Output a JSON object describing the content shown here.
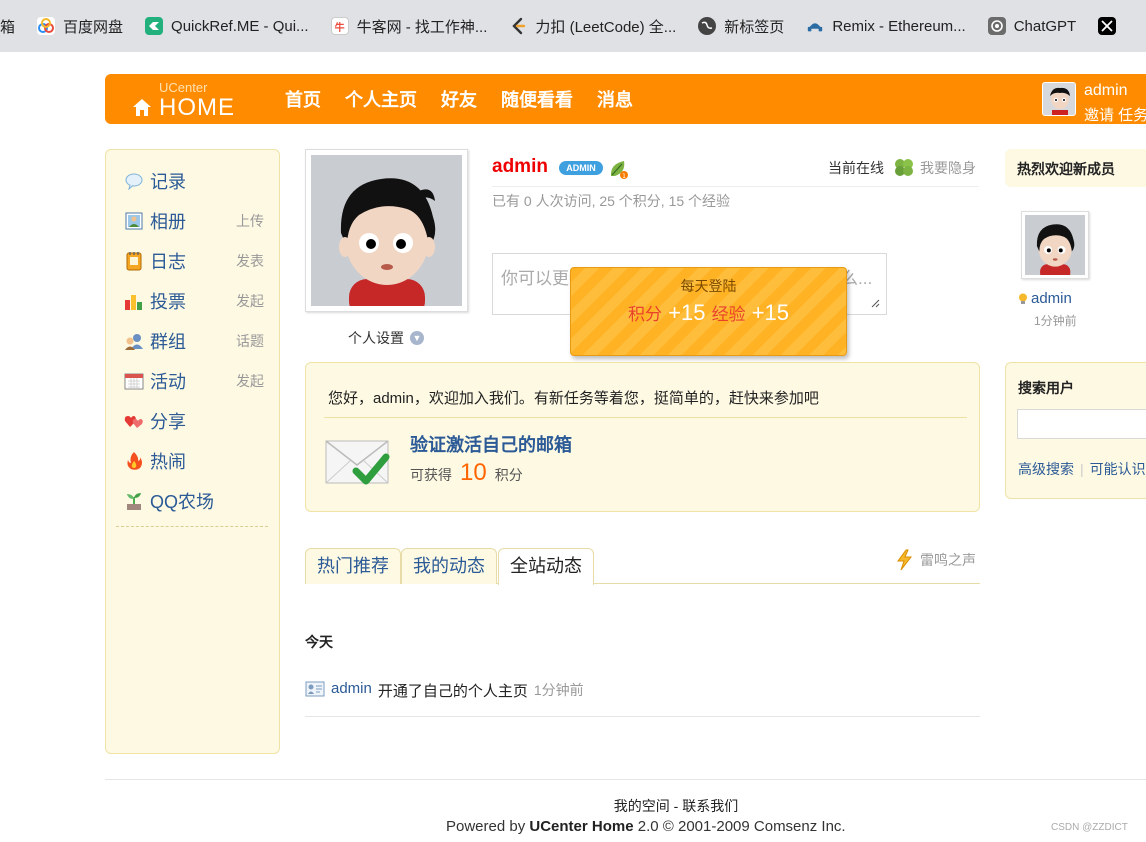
{
  "bookmarks": [
    {
      "label": "箱",
      "color": "#888888"
    },
    {
      "label": "百度网盘",
      "color": "#2a8ef5"
    },
    {
      "label": "QuickRef.ME - Qui...",
      "color": "#22b07d"
    },
    {
      "label": "牛客网 - 找工作神...",
      "color": "#e94b3c"
    },
    {
      "label": "力扣 (LeetCode) 全...",
      "color": "#333333"
    },
    {
      "label": "新标签页",
      "color": "#555555"
    },
    {
      "label": "Remix - Ethereum...",
      "color": "#2b6ca3"
    },
    {
      "label": "ChatGPT",
      "color": "#555555"
    },
    {
      "label": "",
      "color": "#000000"
    }
  ],
  "header": {
    "logo_small": "UCenter",
    "logo_big": "HOME",
    "nav": [
      "首页",
      "个人主页",
      "好友",
      "随便看看",
      "消息"
    ],
    "username": "admin",
    "user_links": "邀请 任务"
  },
  "sidebar": {
    "items": [
      {
        "label": "记录",
        "action": "",
        "icon": "chat-bubble-icon"
      },
      {
        "label": "相册",
        "action": "上传",
        "icon": "photo-icon"
      },
      {
        "label": "日志",
        "action": "发表",
        "icon": "notebook-icon"
      },
      {
        "label": "投票",
        "action": "发起",
        "icon": "bar-chart-icon"
      },
      {
        "label": "群组",
        "action": "话题",
        "icon": "group-icon"
      },
      {
        "label": "活动",
        "action": "发起",
        "icon": "calendar-icon"
      },
      {
        "label": "分享",
        "action": "",
        "icon": "hearts-icon"
      },
      {
        "label": "热闹",
        "action": "",
        "icon": "fire-icon"
      },
      {
        "label": "QQ农场",
        "action": "",
        "icon": "sprout-icon"
      }
    ]
  },
  "profile": {
    "name": "admin",
    "badge": "ADMIN",
    "online_label": "当前在线",
    "hide_label": "我要隐身",
    "stats": "已有 0 人次访问, 25 个积分, 15 个经验",
    "settings_label": "个人设置",
    "status_placeholder": "你可以更新自己的状态，让好友知道你在做什么..."
  },
  "popup": {
    "title": "每天登陆",
    "points_label": "积分",
    "points_value": "+15",
    "exp_label": "经验",
    "exp_value": "+15"
  },
  "task": {
    "message": "您好，admin，欢迎加入我们。有新任务等着您，挺简单的，赶快来参加吧",
    "title": "验证激活自己的邮箱",
    "reward_prefix": "可获得",
    "reward_value": "10",
    "reward_suffix": "积分"
  },
  "tabs": [
    {
      "label": "热门推荐",
      "active": false
    },
    {
      "label": "我的动态",
      "active": false
    },
    {
      "label": "全站动态",
      "active": true
    }
  ],
  "thunder_label": "雷鸣之声",
  "feed": {
    "section_title": "今天",
    "items": [
      {
        "user": "admin",
        "text": "开通了自己的个人主页",
        "time": "1分钟前"
      }
    ]
  },
  "right": {
    "new_members_title": "热烈欢迎新成员",
    "member_name": "admin",
    "member_time": "1分钟前",
    "search_title": "搜索用户",
    "search_links": [
      "高级搜索",
      "可能认识"
    ]
  },
  "footer": {
    "links": "我的空间 - 联系我们",
    "powered_prefix": "Powered by",
    "powered_product": "UCenter Home",
    "powered_suffix": "2.0 © 2001-2009 Comsenz Inc.",
    "watermark": "CSDN @ZZDICT"
  },
  "colors": {
    "header_orange": "#ff8c00",
    "link_blue": "#2b5a96",
    "panel_cream": "#fdf9e3",
    "name_red": "#ee0000",
    "reward_orange": "#ff6600"
  }
}
